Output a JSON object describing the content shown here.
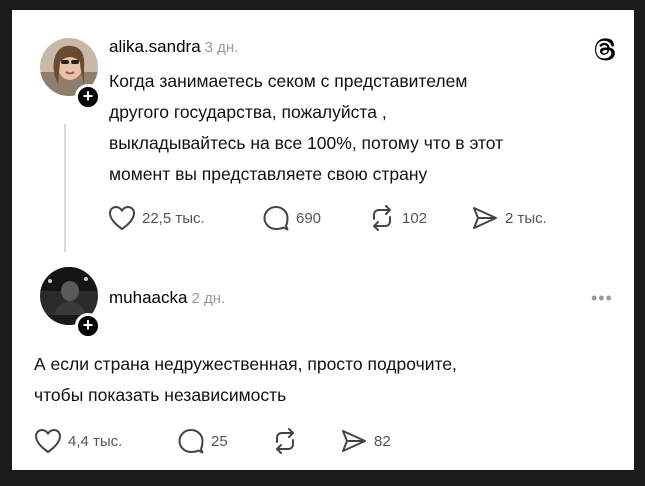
{
  "posts": [
    {
      "username": "alika.sandra",
      "time": "3 дн.",
      "text_lines": [
        "Когда занимаетесь секом с представителем",
        "другого государства, пожалуйста ,",
        "выкладывайтесь на все 100%, потому что в этот",
        "момент вы представляете свою страну"
      ],
      "likes": "22,5 тыс.",
      "comments": "690",
      "reposts": "102",
      "shares": "2 тыс."
    },
    {
      "username": "muhaacka",
      "time": "2 дн.",
      "text_lines": [
        "А если страна недружественная, просто подрочите,",
        "чтобы показать независимость"
      ],
      "likes": "4,4 тыс.",
      "comments": "25",
      "reposts": "",
      "shares": "82"
    }
  ],
  "icons": {
    "threads": "threads-logo-icon",
    "like": "heart-icon",
    "comment": "comment-bubble-icon",
    "repost": "repost-icon",
    "share": "send-icon",
    "more": "more-icon"
  }
}
